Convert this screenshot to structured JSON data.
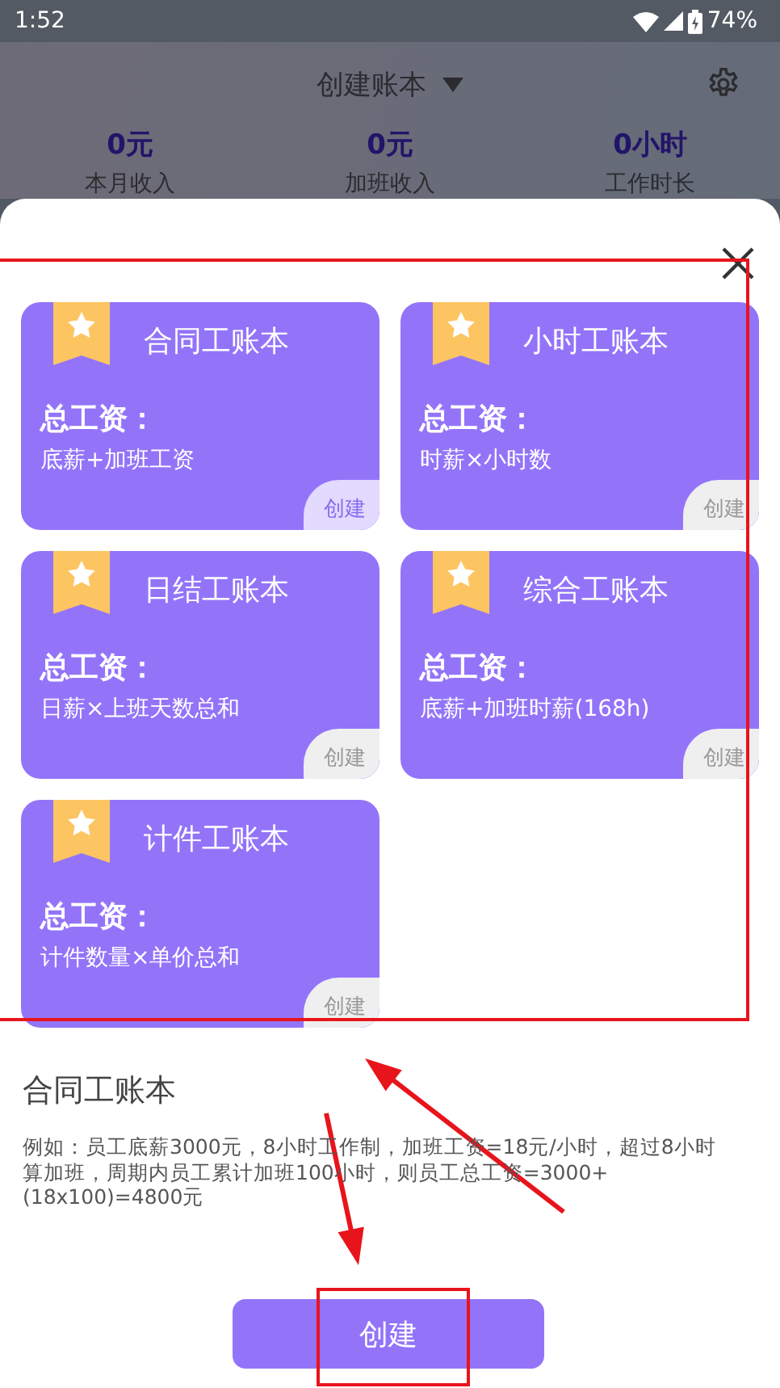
{
  "status_bar": {
    "time": "1:52",
    "battery": "74%"
  },
  "header": {
    "title": "创建账本",
    "stats": [
      {
        "value": "0元",
        "label": "本月收入"
      },
      {
        "value": "0元",
        "label": "加班收入"
      },
      {
        "value": "0小时",
        "label": "工作时长"
      }
    ]
  },
  "sheet": {
    "cards": [
      {
        "title": "合同工账本",
        "formula_label": "总工资：",
        "formula": "底薪+加班工资",
        "action": "创建",
        "selected": true
      },
      {
        "title": "小时工账本",
        "formula_label": "总工资：",
        "formula": "时薪×小时数",
        "action": "创建",
        "selected": false
      },
      {
        "title": "日结工账本",
        "formula_label": "总工资：",
        "formula": "日薪×上班天数总和",
        "action": "创建",
        "selected": false
      },
      {
        "title": "综合工账本",
        "formula_label": "总工资：",
        "formula": "底薪+加班时薪(168h)",
        "action": "创建",
        "selected": false
      },
      {
        "title": "计件工账本",
        "formula_label": "总工资：",
        "formula": "计件数量×单价总和",
        "action": "创建",
        "selected": false
      }
    ],
    "description": {
      "title": "合同工账本",
      "text": "例如：员工底薪3000元，8小时工作制，加班工资=18元/小时，超过8小时算加班，周期内员工累计加班100小时，则员工总工资=3000+(18x100)=4800元"
    },
    "create_button": "创建"
  }
}
